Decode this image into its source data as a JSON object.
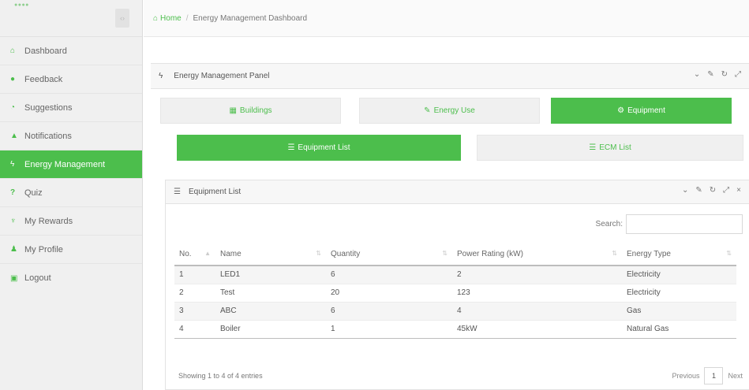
{
  "brand": {
    "logo": "●●●●",
    "collapse_icon": "‹›"
  },
  "sidebar": {
    "items": [
      {
        "label": "Dashboard",
        "icon": "⌂"
      },
      {
        "label": "Feedback",
        "icon": "●"
      },
      {
        "label": "Suggestions",
        "icon": "◔"
      },
      {
        "label": "Notifications",
        "icon": "▲"
      },
      {
        "label": "Energy Management",
        "icon": "ϟ"
      },
      {
        "label": "Quiz",
        "icon": "?"
      },
      {
        "label": "My Rewards",
        "icon": "♆"
      },
      {
        "label": "My Profile",
        "icon": "♟"
      },
      {
        "label": "Logout",
        "icon": "▣"
      }
    ]
  },
  "breadcrumb": {
    "home": "Home",
    "separator": "/",
    "current": "Energy Management Dashboard"
  },
  "panel": {
    "title": "Energy Management Panel",
    "pin": "ϟ"
  },
  "tabs": [
    {
      "label": "Buildings",
      "icon": "▦"
    },
    {
      "label": "Energy Use",
      "icon": "✎"
    },
    {
      "label": "Equipment",
      "icon": "⚙"
    }
  ],
  "subtabs": [
    {
      "label": "Equipment List",
      "icon": "☰"
    },
    {
      "label": "ECM List",
      "icon": "☰"
    }
  ],
  "list_panel": {
    "title": "Equipment List"
  },
  "search": {
    "label": "Search:",
    "placeholder": ""
  },
  "table": {
    "headers": [
      "No.",
      "Name",
      "Quantity",
      "Power Rating (kW)",
      "Energy Type"
    ],
    "rows": [
      [
        "1",
        "LED1",
        "6",
        "2",
        "Electricity"
      ],
      [
        "2",
        "Test",
        "20",
        "123",
        "Electricity"
      ],
      [
        "3",
        "ABC",
        "6",
        "4",
        "Gas"
      ],
      [
        "4",
        "Boiler",
        "1",
        "45kW",
        "Natural Gas"
      ]
    ]
  },
  "footer": {
    "info": "Showing 1 to 4 of 4 entries",
    "previous": "Previous",
    "page": "1",
    "next": "Next"
  },
  "colors": {
    "accent": "#4cbe4c",
    "sidebar_bg": "#f0f0f0"
  }
}
